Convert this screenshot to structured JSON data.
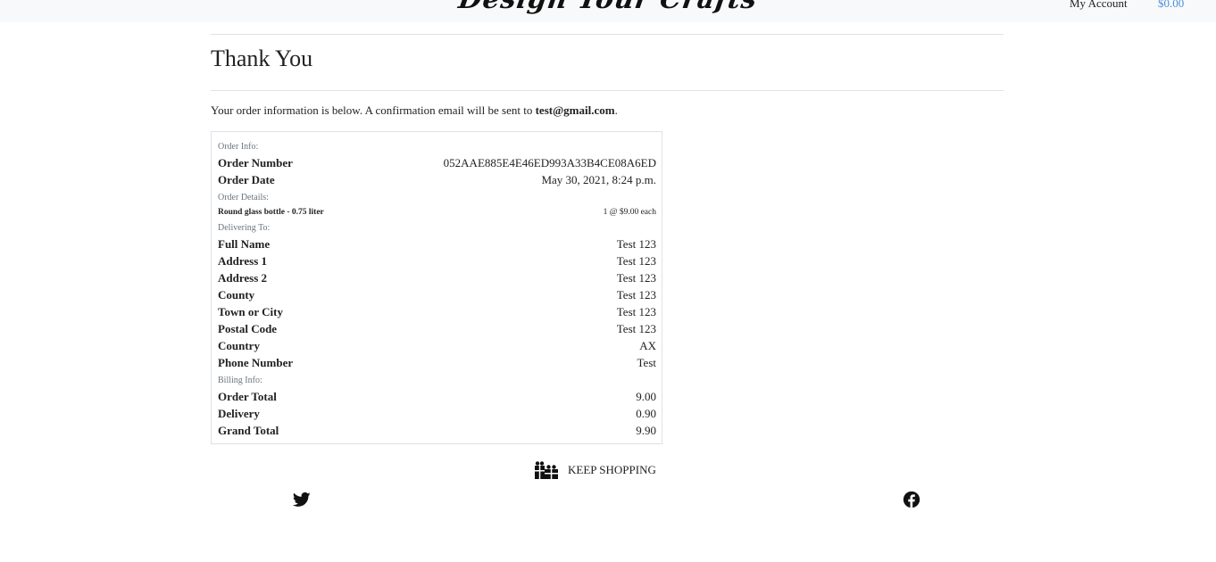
{
  "header": {
    "logo_text": "Design Your Crafts",
    "my_account_label": "My Account",
    "cart_total": "$0.00"
  },
  "page": {
    "title": "Thank You",
    "intro_text": "Your order information is below. A confirmation email will be sent to ",
    "email": "test@gmail.com",
    "intro_end": "."
  },
  "order_info": {
    "section_label": "Order Info:",
    "rows": [
      {
        "label": "Order Number",
        "value": "052AAE885E4E46ED993A33B4CE08A6ED"
      },
      {
        "label": "Order Date",
        "value": "May 30, 2021, 8:24 p.m."
      }
    ]
  },
  "order_details": {
    "section_label": "Order Details:",
    "items": [
      {
        "name": "Round glass bottle - 0.75 liter",
        "qty_price": "1 @ $9.00 each"
      }
    ]
  },
  "delivering_to": {
    "section_label": "Delivering To:",
    "rows": [
      {
        "label": "Full Name",
        "value": "Test 123"
      },
      {
        "label": "Address 1",
        "value": "Test 123"
      },
      {
        "label": "Address 2",
        "value": "Test 123"
      },
      {
        "label": "County",
        "value": "Test 123"
      },
      {
        "label": "Town or City",
        "value": "Test 123"
      },
      {
        "label": "Postal Code",
        "value": "Test 123"
      },
      {
        "label": "Country",
        "value": "AX"
      },
      {
        "label": "Phone Number",
        "value": "Test"
      }
    ]
  },
  "billing_info": {
    "section_label": "Billing Info:",
    "rows": [
      {
        "label": "Order Total",
        "value": "9.00"
      },
      {
        "label": "Delivery",
        "value": "0.90"
      },
      {
        "label": "Grand Total",
        "value": "9.90"
      }
    ]
  },
  "keep_shopping": {
    "label": "KEEP SHOPPING",
    "icon": "gifts-icon"
  },
  "footer": {
    "twitter_icon": "twitter-icon",
    "facebook_icon": "facebook-icon"
  }
}
